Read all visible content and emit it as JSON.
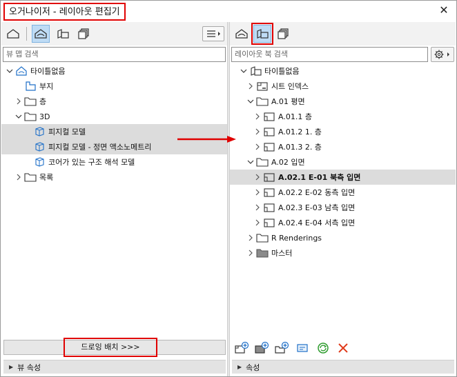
{
  "window": {
    "title": "오거나이저 - 레이아웃 편집기",
    "close": "✕"
  },
  "left": {
    "search_placeholder": "뷰 맵 검색",
    "tree": [
      {
        "label": "타이틀없음",
        "level": 0,
        "chevron": "down",
        "icon": "house",
        "selected": false
      },
      {
        "label": "부지",
        "level": 1,
        "chevron": "none",
        "icon": "site",
        "selected": false
      },
      {
        "label": "층",
        "level": 1,
        "chevron": "right",
        "icon": "folder",
        "selected": false
      },
      {
        "label": "3D",
        "level": 1,
        "chevron": "down",
        "icon": "folder",
        "selected": false
      },
      {
        "label": "피지컬 모델",
        "level": 2,
        "chevron": "none",
        "icon": "cube",
        "selected": true
      },
      {
        "label": "피지컬 모델 - 정면 액소노메트리",
        "level": 2,
        "chevron": "none",
        "icon": "cube",
        "selected": true
      },
      {
        "label": "코어가 있는 구조 해석 모델",
        "level": 2,
        "chevron": "none",
        "icon": "cube",
        "selected": false
      },
      {
        "label": "목록",
        "level": 1,
        "chevron": "right",
        "icon": "folder",
        "selected": false
      }
    ],
    "place_drawing_button": "드로잉 배치 >>>",
    "props_label": "뷰 속성"
  },
  "right": {
    "search_placeholder": "레이아웃 북 검색",
    "tree": [
      {
        "label": "타이틀없음",
        "level": 0,
        "chevron": "down",
        "icon": "book",
        "bold": false,
        "selected": false
      },
      {
        "label": "시트 인덱스",
        "level": 1,
        "chevron": "right",
        "icon": "sheet",
        "bold": false,
        "selected": false
      },
      {
        "label": "A.01 평면",
        "level": 1,
        "chevron": "down",
        "icon": "folder",
        "bold": false,
        "selected": false
      },
      {
        "label": "A.01.1 층",
        "level": 2,
        "chevron": "right",
        "icon": "layout",
        "bold": false,
        "selected": false
      },
      {
        "label": "A.01.2 1. 층",
        "level": 2,
        "chevron": "right",
        "icon": "layout",
        "bold": false,
        "selected": false
      },
      {
        "label": "A.01.3 2. 층",
        "level": 2,
        "chevron": "right",
        "icon": "layout",
        "bold": false,
        "selected": false
      },
      {
        "label": "A.02 입면",
        "level": 1,
        "chevron": "down",
        "icon": "folder",
        "bold": false,
        "selected": false
      },
      {
        "label": "A.02.1 E-01 북측 입면",
        "level": 2,
        "chevron": "right",
        "icon": "layout",
        "bold": true,
        "selected": true
      },
      {
        "label": "A.02.2 E-02 동측 입면",
        "level": 2,
        "chevron": "right",
        "icon": "layout",
        "bold": false,
        "selected": false
      },
      {
        "label": "A.02.3 E-03 남측 입면",
        "level": 2,
        "chevron": "right",
        "icon": "layout",
        "bold": false,
        "selected": false
      },
      {
        "label": "A.02.4 E-04 서측 입면",
        "level": 2,
        "chevron": "right",
        "icon": "layout",
        "bold": false,
        "selected": false
      },
      {
        "label": "R Renderings",
        "level": 1,
        "chevron": "right",
        "icon": "folder",
        "bold": false,
        "selected": false
      },
      {
        "label": "마스터",
        "level": 1,
        "chevron": "right",
        "icon": "folder-filled",
        "bold": false,
        "selected": false
      }
    ],
    "props_label": "속성"
  },
  "colors": {
    "accent_red": "#e00000",
    "active_tab": "#bfdcf5",
    "selection": "#dcdcdc",
    "refresh_green": "#2e9c2e",
    "delete_red": "#e03a1a",
    "icon_blue": "#1e6fc8"
  }
}
